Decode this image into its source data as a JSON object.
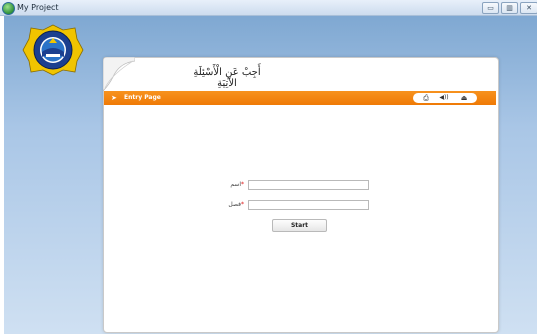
{
  "window": {
    "title": "My Project",
    "minimize_glyph": "▭",
    "maximize_glyph": "▥",
    "close_glyph": "✕",
    "app_icon": "globe-icon"
  },
  "logo": {
    "name": "institution-logo",
    "lettering_top": "MADRASAH ALIYAH",
    "lettering_bottom": "NEGERI"
  },
  "panel": {
    "arabic_title": "أَجِبْ عَنِ الْأَسْئِلَةِ الآتِيَةِ",
    "nav_bar": {
      "label": "Entry Page",
      "arrow_glyph": "➤",
      "color": "#f7921e",
      "tools": [
        {
          "icon": "print-icon",
          "glyph": "⎙"
        },
        {
          "icon": "speaker-icon",
          "glyph": "◀))"
        },
        {
          "icon": "eject-icon",
          "glyph": "⏏"
        }
      ]
    }
  },
  "form": {
    "name_label": "اسم",
    "class_label": "فصل",
    "required_mark": "*",
    "name_value": "",
    "class_value": "",
    "start_label": "Start"
  },
  "colors": {
    "accent": "#f7921e",
    "background_top": "#7fa8d2",
    "background_bottom": "#cfe0f2"
  }
}
